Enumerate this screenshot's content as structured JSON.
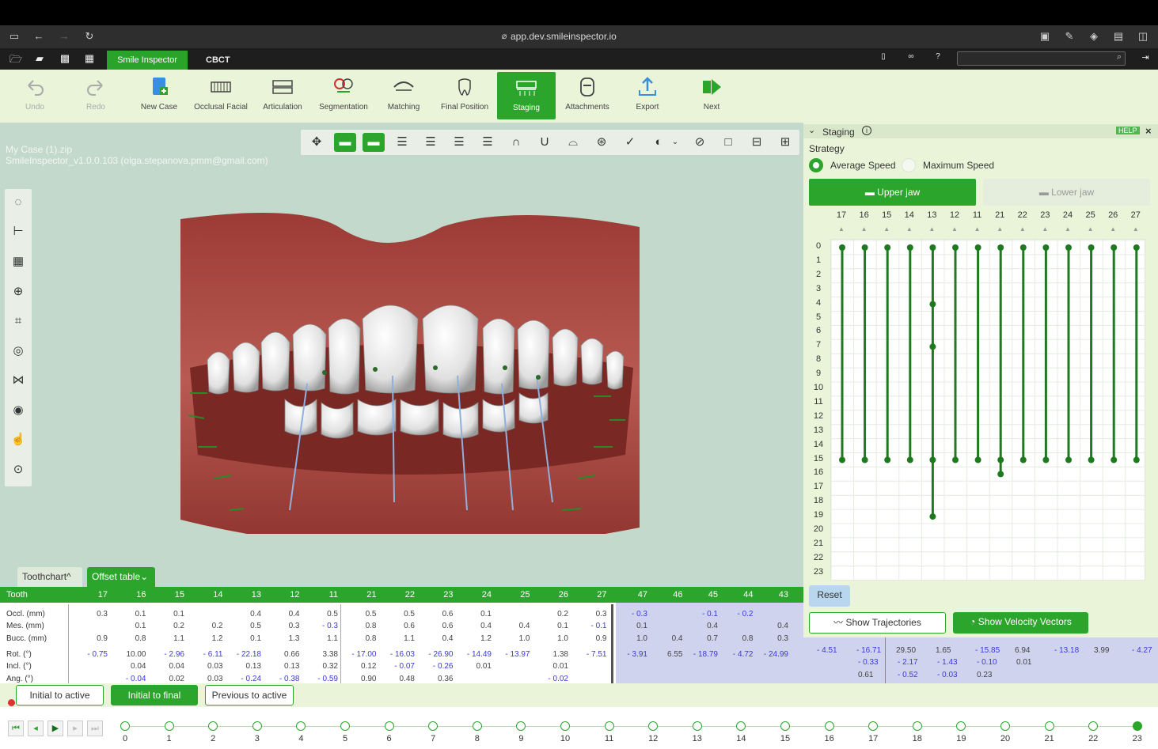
{
  "browser": {
    "url": "app.dev.smileinspector.io"
  },
  "app": {
    "tabs": [
      "Smile Inspector",
      "CBCT"
    ]
  },
  "toolbar": {
    "undo": "Undo",
    "redo": "Redo",
    "new_case": "New Case",
    "occlusal": "Occlusal Facial",
    "articulation": "Articulation",
    "segmentation": "Segmentation",
    "matching": "Matching",
    "final_position": "Final Position",
    "staging": "Staging",
    "attachments": "Attachments",
    "export": "Export",
    "next": "Next"
  },
  "case": {
    "file": "My Case (1).zip",
    "version": "SmileInspector_v1.0.0.103 (olga.stepanova.pmm@gmail.com)"
  },
  "bottom_tabs": {
    "toothchart": "Toothchart",
    "offset": "Offset table"
  },
  "table": {
    "header_label": "Tooth",
    "teeth": [
      "17",
      "16",
      "15",
      "14",
      "13",
      "12",
      "11",
      "21",
      "22",
      "23",
      "24",
      "25",
      "26",
      "27",
      "47",
      "46",
      "45",
      "44",
      "43"
    ],
    "row_labels": [
      "Occl. (mm)",
      "Mes. (mm)",
      "Bucc. (mm)",
      "Rot. (°)",
      "Incl. (°)",
      "Ang. (°)"
    ],
    "rows": [
      [
        "0.3",
        "0.1",
        "0.1",
        "",
        "0.4",
        "0.4",
        "0.5",
        "0.5",
        "0.5",
        "0.6",
        "0.1",
        "",
        "0.2",
        "0.3",
        "- 0.3",
        "",
        "- 0.1",
        "- 0.2",
        ""
      ],
      [
        "",
        "0.1",
        "0.2",
        "0.2",
        "0.5",
        "0.3",
        "- 0.3",
        "0.8",
        "0.6",
        "0.6",
        "0.4",
        "0.4",
        "0.1",
        "- 0.1",
        "0.1",
        "",
        "0.4",
        "",
        "0.4"
      ],
      [
        "0.9",
        "0.8",
        "1.1",
        "1.2",
        "0.1",
        "1.3",
        "1.1",
        "0.8",
        "1.1",
        "0.4",
        "1.2",
        "1.0",
        "1.0",
        "0.9",
        "1.0",
        "0.4",
        "0.7",
        "0.8",
        "0.3"
      ],
      [
        "- 0.75",
        "10.00",
        "- 2.96",
        "- 6.11",
        "- 22.18",
        "0.66",
        "3.38",
        "- 17.00",
        "- 16.03",
        "- 26.90",
        "- 14.49",
        "- 13.97",
        "1.38",
        "- 7.51",
        "- 3.91",
        "6.55",
        "- 18.79",
        "- 4.72",
        "- 24.99"
      ],
      [
        "",
        "0.04",
        "0.04",
        "0.03",
        "0.13",
        "0.13",
        "0.32",
        "0.12",
        "- 0.07",
        "- 0.26",
        "0.01",
        "",
        "0.01",
        "",
        "",
        "",
        "",
        "",
        ""
      ],
      [
        "",
        "- 0.04",
        "0.02",
        "0.03",
        "- 0.24",
        "- 0.38",
        "- 0.59",
        "0.90",
        "0.48",
        "0.36",
        "",
        "",
        "- 0.02",
        "",
        "",
        "",
        "",
        "",
        ""
      ]
    ],
    "rot_extra": [
      "- 4.51",
      "- 16.71",
      "29.50",
      "1.65",
      "- 15.85",
      "6.94",
      "- 13.18",
      "3.99",
      "- 4.27"
    ],
    "incl_extra": [
      "- 0.33",
      "- 2.17",
      "- 1.43",
      "- 0.10",
      "0.01"
    ],
    "ang_extra": [
      "0.61",
      "- 0.52",
      "- 0.03",
      "0.23"
    ]
  },
  "actions": {
    "initial_active": "Initial to active",
    "initial_final": "Initial to final",
    "previous_active": "Previous to active"
  },
  "timeline": {
    "stages": [
      "0",
      "1",
      "2",
      "3",
      "4",
      "5",
      "6",
      "7",
      "8",
      "9",
      "10",
      "11",
      "12",
      "13",
      "14",
      "15",
      "16",
      "17",
      "18",
      "19",
      "20",
      "21",
      "22",
      "23"
    ],
    "current": 23
  },
  "panel": {
    "title": "Staging",
    "help": "HELP",
    "strategy_label": "Strategy",
    "avg_speed": "Average Speed",
    "max_speed": "Maximum Speed",
    "upper_jaw": "Upper jaw",
    "lower_jaw": "Lower jaw",
    "teeth": [
      "17",
      "16",
      "15",
      "14",
      "13",
      "12",
      "11",
      "21",
      "22",
      "23",
      "24",
      "25",
      "26",
      "27"
    ],
    "rows": [
      "0",
      "1",
      "2",
      "3",
      "4",
      "5",
      "6",
      "7",
      "8",
      "9",
      "10",
      "11",
      "12",
      "13",
      "14",
      "15",
      "16",
      "17",
      "18",
      "19",
      "20",
      "21",
      "22",
      "23"
    ],
    "reset": "Reset",
    "show_trajectories": "Show Trajectories",
    "show_velocity": "Show Velocity Vectors"
  },
  "staging_data": {
    "end_stage": [
      15,
      15,
      15,
      15,
      19,
      15,
      15,
      16,
      15,
      15,
      15,
      15,
      15,
      15
    ],
    "extra_marks": [
      [],
      [],
      [],
      [],
      [
        4,
        7,
        15
      ],
      [],
      [],
      [
        15
      ],
      [],
      [],
      [],
      [],
      [],
      []
    ]
  },
  "colors": {
    "accent": "#2ca52c",
    "panel_bg": "#eaf4d8",
    "viewport": "#c3d9cc",
    "gum": "#a8453f",
    "purple": "#cfd3ee"
  }
}
